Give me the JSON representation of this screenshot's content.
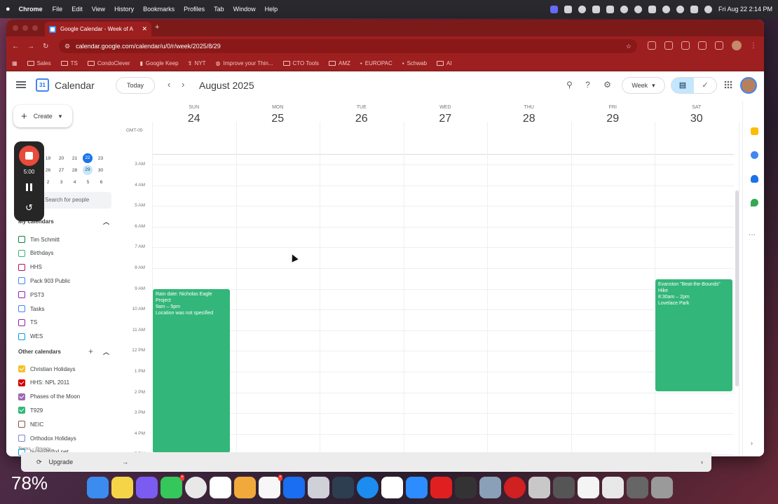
{
  "menubar": {
    "app_name": "Chrome",
    "menus": [
      "File",
      "Edit",
      "View",
      "History",
      "Bookmarks",
      "Profiles",
      "Tab",
      "Window",
      "Help"
    ],
    "clock": "Fri Aug 22  2:14 PM"
  },
  "browser": {
    "tab_title": "Google Calendar - Week of A",
    "url": "calendar.google.com/calendar/u/0/r/week/2025/8/29",
    "bookmarks": [
      "Sales",
      "TS",
      "CondoClever",
      "Google Keep",
      "NYT",
      "Improve your Thin...",
      "CTO Tools",
      "AMZ",
      "EUROPAC",
      "Schwab",
      "AI"
    ]
  },
  "calendar": {
    "app_title": "Calendar",
    "today_label": "Today",
    "month_title": "August 2025",
    "view_label": "Week",
    "create_label": "Create",
    "search_people_placeholder": "Search for people",
    "timezone": "GMT-05",
    "days": [
      {
        "dow": "SUN",
        "num": "24"
      },
      {
        "dow": "MON",
        "num": "25"
      },
      {
        "dow": "TUE",
        "num": "26"
      },
      {
        "dow": "WED",
        "num": "27"
      },
      {
        "dow": "THU",
        "num": "28"
      },
      {
        "dow": "FRI",
        "num": "29"
      },
      {
        "dow": "SAT",
        "num": "30"
      }
    ],
    "hours": [
      "3 AM",
      "4 AM",
      "5 AM",
      "6 AM",
      "7 AM",
      "8 AM",
      "9 AM",
      "10 AM",
      "11 AM",
      "12 PM",
      "1 PM",
      "2 PM",
      "3 PM",
      "4 PM",
      "5 PM"
    ],
    "mini_calendar": {
      "rows": [
        [
          "19",
          "20",
          "21",
          "22",
          "23"
        ],
        [
          "26",
          "27",
          "28",
          "29",
          "30"
        ],
        [
          "2",
          "3",
          "4",
          "5",
          "6"
        ]
      ]
    },
    "events": [
      {
        "title": "Rain date: Nicholas Eagle Project",
        "time": "9am – 5pm",
        "location": "Location was not specified"
      },
      {
        "title": "Evanston \"Beat-the-Bounds\" Hike",
        "time": "8:30am – 2pm",
        "location": "Lovelace Park"
      }
    ],
    "my_calendars_label": "My calendars",
    "my_calendars": [
      {
        "name": "Tim Schmitt",
        "color": "#0b8043",
        "checked": false
      },
      {
        "name": "Birthdays",
        "color": "#33b679",
        "checked": false
      },
      {
        "name": "HHS",
        "color": "#ad1457",
        "checked": false
      },
      {
        "name": "Pack 903 Public",
        "color": "#4285f4",
        "checked": false
      },
      {
        "name": "PST3",
        "color": "#8e24aa",
        "checked": false
      },
      {
        "name": "Tasks",
        "color": "#4285f4",
        "checked": false
      },
      {
        "name": "TS",
        "color": "#8e24aa",
        "checked": false
      },
      {
        "name": "WES",
        "color": "#039be5",
        "checked": false
      }
    ],
    "other_calendars_label": "Other calendars",
    "other_calendars": [
      {
        "name": "Christian Holidays",
        "color": "#f6bf26",
        "checked": true
      },
      {
        "name": "HHS: NPL 2011",
        "color": "#d50000",
        "checked": true
      },
      {
        "name": "Phases of the Moon",
        "color": "#9e69af",
        "checked": true
      },
      {
        "name": "T929",
        "color": "#33b679",
        "checked": true
      },
      {
        "name": "NEIC",
        "color": "#795548",
        "checked": false
      },
      {
        "name": "Orthodox Holidays",
        "color": "#7986cb",
        "checked": false
      },
      {
        "name": "tschmitt@xl.net",
        "color": "#039be5",
        "checked": false
      }
    ],
    "terms": "Terms – Privacy"
  },
  "recorder": {
    "time": "5:00"
  },
  "behind_window": {
    "upgrade_label": "Upgrade"
  },
  "desktop": {
    "battery_percent": "78%"
  }
}
